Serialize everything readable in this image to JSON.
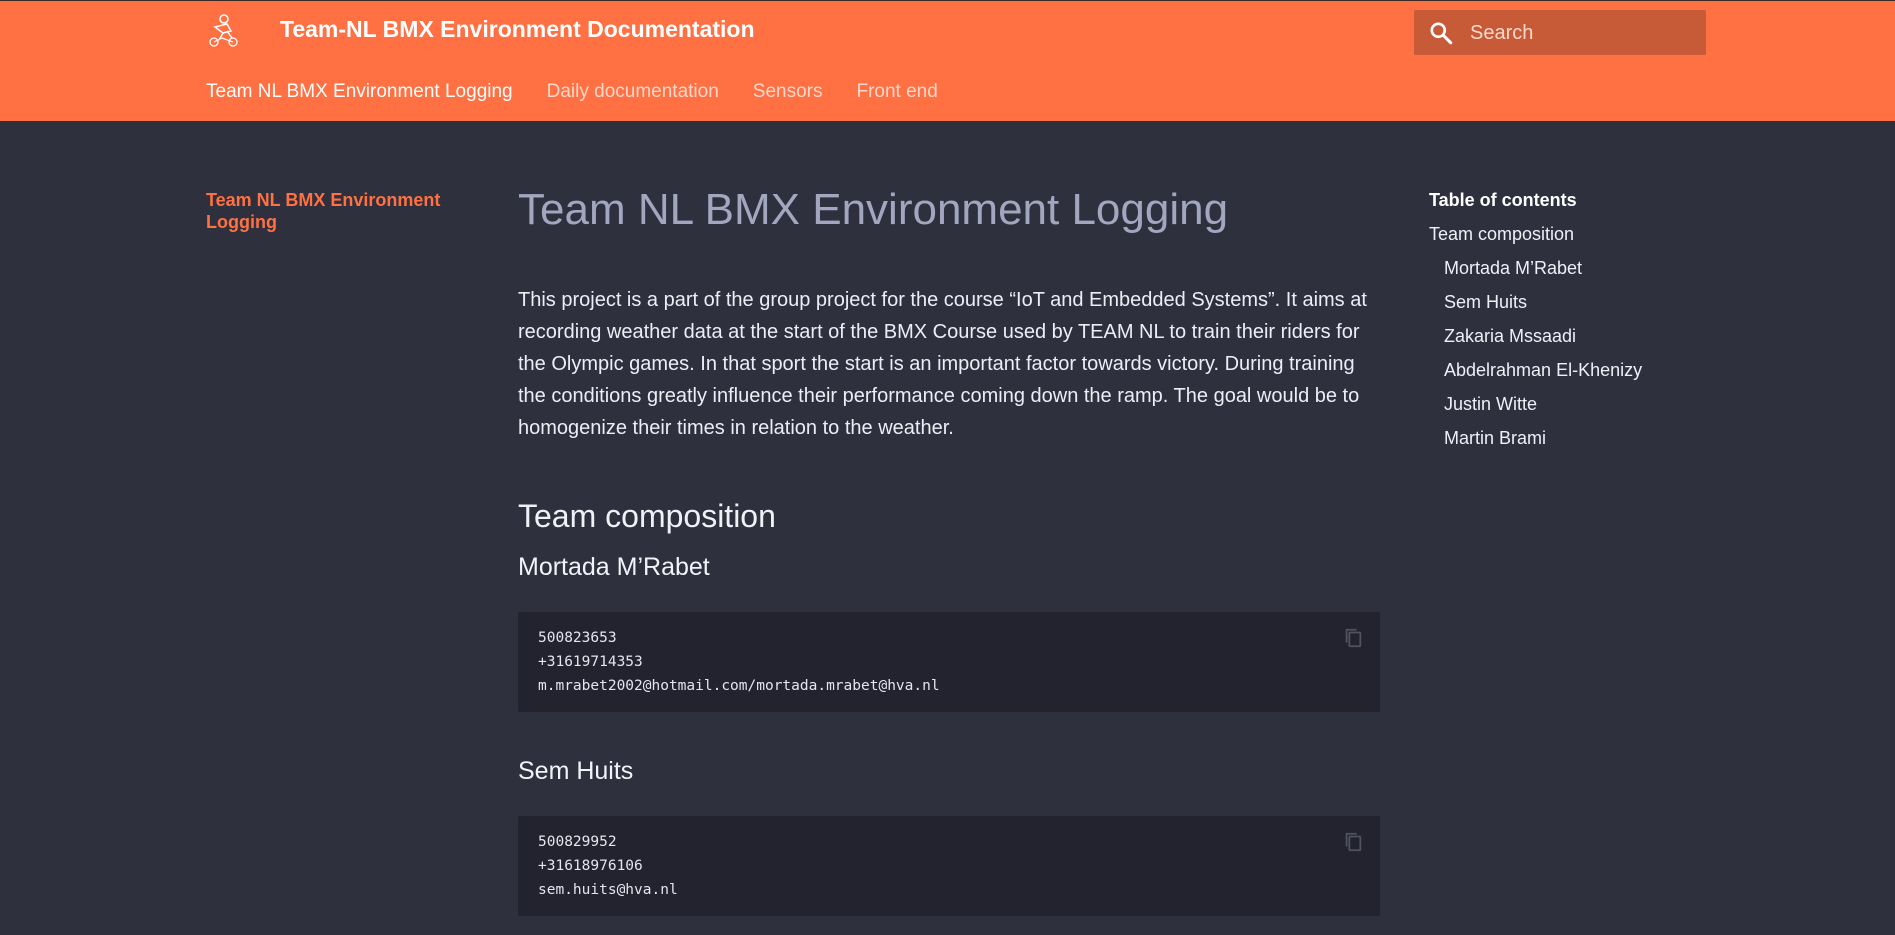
{
  "header": {
    "site_title": "Team-NL BMX Environment Documentation",
    "search_placeholder": "Search",
    "accent_color": "#ff7043",
    "tabs": [
      {
        "label": "Team NL BMX Environment Logging",
        "active": true
      },
      {
        "label": "Daily documentation",
        "active": false
      },
      {
        "label": "Sensors",
        "active": false
      },
      {
        "label": "Front end",
        "active": false
      }
    ]
  },
  "sidebar": {
    "active_page": "Team NL BMX Environment Logging"
  },
  "main": {
    "title": "Team NL BMX Environment Logging",
    "intro": "This project is a part of the group project for the course “IoT and Embedded Systems”. It aims at recording weather data at the start of the BMX Course used by TEAM NL to train their riders for the Olympic games. In that sport the start is an important factor towards victory. During training the conditions greatly influence their performance coming down the ramp. The goal would be to homogenize their times in relation to the weather.",
    "section_heading": "Team composition",
    "members": [
      {
        "name": "Mortada M’Rabet",
        "lines": [
          "500823653",
          "+31619714353",
          "m.mrabet2002@hotmail.com/mortada.mrabet@hva.nl"
        ]
      },
      {
        "name": "Sem Huits",
        "lines": [
          "500829952",
          "+31618976106",
          "sem.huits@hva.nl"
        ]
      }
    ]
  },
  "toc": {
    "title": "Table of contents",
    "section": "Team composition",
    "items": [
      "Mortada M’Rabet",
      "Sem Huits",
      "Zakaria Mssaadi",
      "Abdelrahman El-Khenizy",
      "Justin Witte",
      "Martin Brami"
    ]
  },
  "icons": {
    "logo": "bmx-rider-logo-icon",
    "search": "search-icon",
    "copy": "copy-icon"
  }
}
